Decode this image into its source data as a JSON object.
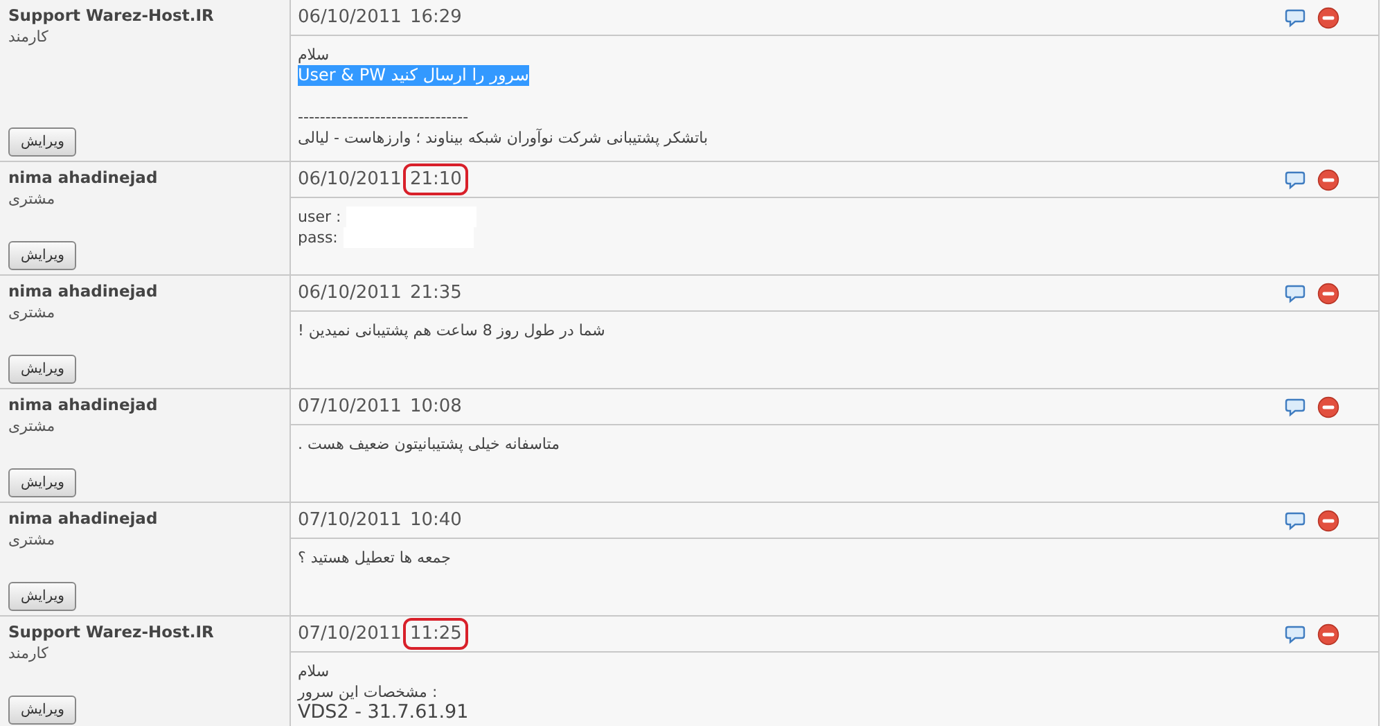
{
  "posts": [
    {
      "author": "Support Warez-Host.IR",
      "role": "کارمند",
      "edit_button": "ویرایش",
      "date": "06/10/2011",
      "time": "16:29",
      "circled": false,
      "lines": [
        {
          "text": "سلام",
          "selected": false,
          "redacted": false,
          "kind": "normal"
        },
        {
          "text": "User & PW سرور را ارسال کنید",
          "selected": true,
          "redacted": false,
          "kind": "normal"
        },
        {
          "text": "-------------------------------",
          "selected": false,
          "redacted": false,
          "kind": "spaced"
        },
        {
          "text": "باتشکر پشتیبانی شرکت نوآوران شبکه بیناوند ؛ وارزهاست - لیالی",
          "selected": false,
          "redacted": false,
          "kind": "normal"
        }
      ]
    },
    {
      "author": "nima ahadinejad",
      "role": "مشتری",
      "edit_button": "ویرایش",
      "date": "06/10/2011",
      "time": "21:10",
      "circled": true,
      "lines": [
        {
          "text": "user :",
          "selected": false,
          "redacted": true,
          "kind": "normal"
        },
        {
          "text": "pass:",
          "selected": false,
          "redacted": true,
          "kind": "normal"
        }
      ]
    },
    {
      "author": "nima ahadinejad",
      "role": "مشتری",
      "edit_button": "ویرایش",
      "date": "06/10/2011",
      "time": "21:35",
      "circled": false,
      "lines": [
        {
          "text": "! شما در طول روز 8 ساعت هم پشتیبانی نمیدین",
          "selected": false,
          "redacted": false,
          "kind": "normal"
        }
      ]
    },
    {
      "author": "nima ahadinejad",
      "role": "مشتری",
      "edit_button": "ویرایش",
      "date": "07/10/2011",
      "time": "10:08",
      "circled": false,
      "lines": [
        {
          "text": ". متاسفانه خیلی پشتیبانیتون ضعیف هست",
          "selected": false,
          "redacted": false,
          "kind": "normal"
        }
      ]
    },
    {
      "author": "nima ahadinejad",
      "role": "مشتری",
      "edit_button": "ویرایش",
      "date": "07/10/2011",
      "time": "10:40",
      "circled": false,
      "lines": [
        {
          "text": "جمعه ها تعطیل هستید ؟",
          "selected": false,
          "redacted": false,
          "kind": "normal"
        }
      ]
    },
    {
      "author": "Support Warez-Host.IR",
      "role": "کارمند",
      "edit_button": "ویرایش",
      "date": "07/10/2011",
      "time": "11:25",
      "circled": true,
      "lines": [
        {
          "text": "سلام",
          "selected": false,
          "redacted": false,
          "kind": "normal"
        },
        {
          "text": "مشخصات این سرور :",
          "selected": false,
          "redacted": false,
          "kind": "normal"
        },
        {
          "text": "VDS2 - 31.7.61.91",
          "selected": false,
          "redacted": false,
          "kind": "large"
        }
      ]
    }
  ]
}
